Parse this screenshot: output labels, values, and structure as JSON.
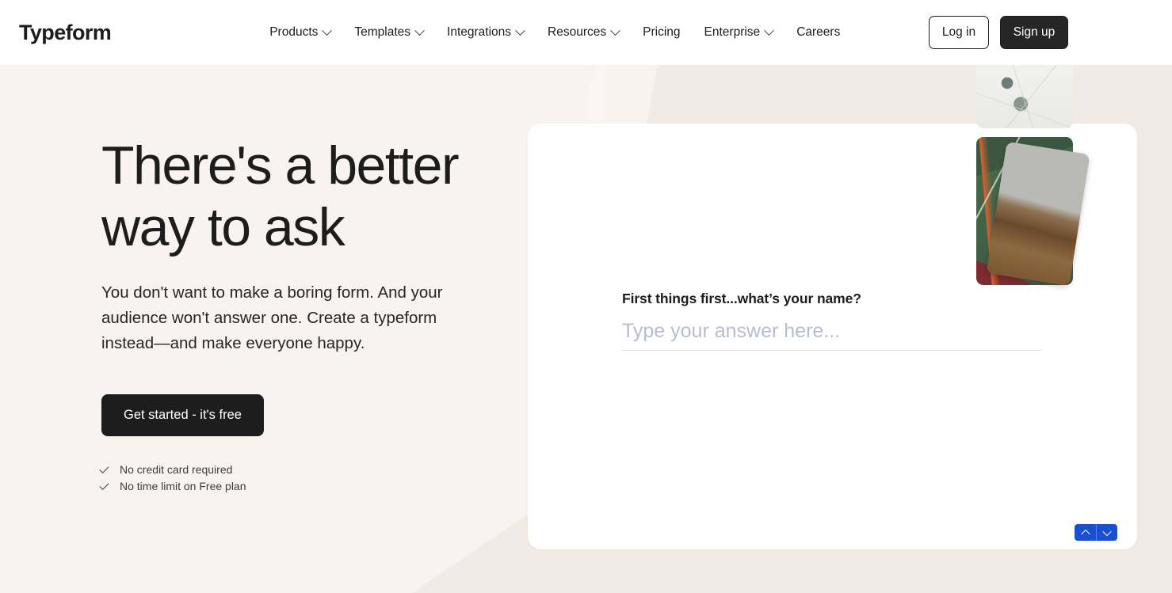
{
  "header": {
    "brand": "Typeform",
    "nav_items": [
      {
        "label": "Products",
        "has_dropdown": true
      },
      {
        "label": "Templates",
        "has_dropdown": true
      },
      {
        "label": "Integrations",
        "has_dropdown": true
      },
      {
        "label": "Resources",
        "has_dropdown": true
      },
      {
        "label": "Pricing",
        "has_dropdown": false
      },
      {
        "label": "Enterprise",
        "has_dropdown": true
      },
      {
        "label": "Careers",
        "has_dropdown": false
      }
    ],
    "login_label": "Log in",
    "signup_label": "Sign up"
  },
  "hero": {
    "title": "There's a better way to ask",
    "subtitle": "You don't want to make a boring form. And your audience won't answer one. Create a typeform instead—and make everyone happy.",
    "cta_label": "Get started - it's free",
    "perks": [
      "No credit card required",
      "No time limit on Free plan"
    ]
  },
  "form_preview": {
    "question": "First things first...what’s your name?",
    "answer_value": "",
    "answer_placeholder": "Type your answer here...",
    "nav_up_label": "Previous question",
    "nav_down_label": "Next question"
  },
  "colors": {
    "hero_background": "#f8f2f1",
    "accent_beige": "#f2eae4",
    "header_background": "#ffffff",
    "text_primary": "#1d1d1d",
    "cta_background": "#1d1d1d",
    "form_nav_blue": "#1a4fd0",
    "placeholder_gray": "#b8bcd0"
  }
}
